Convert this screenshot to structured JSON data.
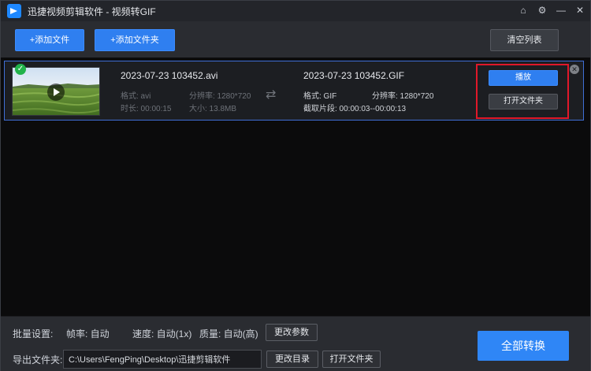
{
  "window": {
    "title": "迅捷视频剪辑软件 - 视频转GIF",
    "actions": [
      "home-icon",
      "settings-icon",
      "minimize-icon",
      "close-icon"
    ]
  },
  "toolbar": {
    "add_file": "+添加文件",
    "add_folder": "+添加文件夹",
    "clear_list": "清空列表"
  },
  "items": [
    {
      "status": "done",
      "source": {
        "name": "2023-07-23 103452.avi",
        "format": "格式: avi",
        "resolution": "分辨率: 1280*720",
        "duration": "时长: 00:00:15",
        "size": "大小: 13.8MB"
      },
      "output": {
        "name": "2023-07-23 103452.GIF",
        "format": "格式: GIF",
        "resolution": "分辨率: 1280*720",
        "clip": "截取片段: 00:00:03--00:00:13"
      },
      "actions": {
        "play": "播放",
        "open_folder": "打开文件夹"
      }
    }
  ],
  "batch": {
    "label": "批量设置:",
    "frame_rate": "帧率: 自动",
    "speed": "速度: 自动(1x)",
    "quality": "质量: 自动(高)",
    "change_params": "更改参数"
  },
  "export": {
    "label": "导出文件夹:",
    "path": "C:\\Users\\FengPing\\Desktop\\迅捷剪辑软件",
    "change_dir": "更改目录",
    "open_folder": "打开文件夹"
  },
  "convert_all": "全部转换",
  "colors": {
    "accent": "#2f86f6",
    "highlight_box": "#e0182a",
    "success": "#21b24a"
  }
}
